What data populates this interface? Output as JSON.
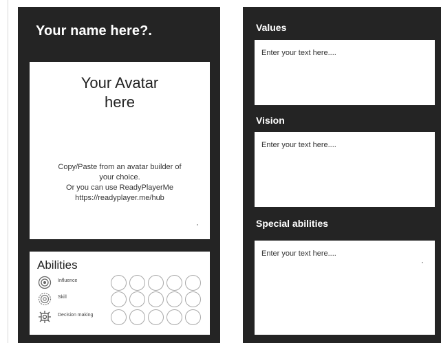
{
  "left_card": {
    "title": "Your name here?.",
    "avatar": {
      "title": "Your Avatar\nhere",
      "info": "Copy/Paste from an avatar builder of\nyour choice.\nOr you can use ReadyPlayerMe\nhttps://readyplayer.me/hub"
    },
    "abilities": {
      "title": "Abilities",
      "items": [
        {
          "label": "Influence",
          "icon": "influence-icon",
          "rating": 0,
          "max": 5
        },
        {
          "label": "Skill",
          "icon": "skill-icon",
          "rating": 0,
          "max": 5
        },
        {
          "label": "Decision making",
          "icon": "decision-making-icon",
          "rating": 0,
          "max": 5
        }
      ]
    }
  },
  "right_card": {
    "values": {
      "title": "Values",
      "text": "Enter your text here...."
    },
    "vision": {
      "title": "Vision",
      "text": "Enter your text here...."
    },
    "special": {
      "title": "Special abilities",
      "text": "Enter your text here...."
    }
  },
  "colors": {
    "card_background": "#242424",
    "panel_background": "#ffffff",
    "circle_border": "#a9a9a9"
  }
}
